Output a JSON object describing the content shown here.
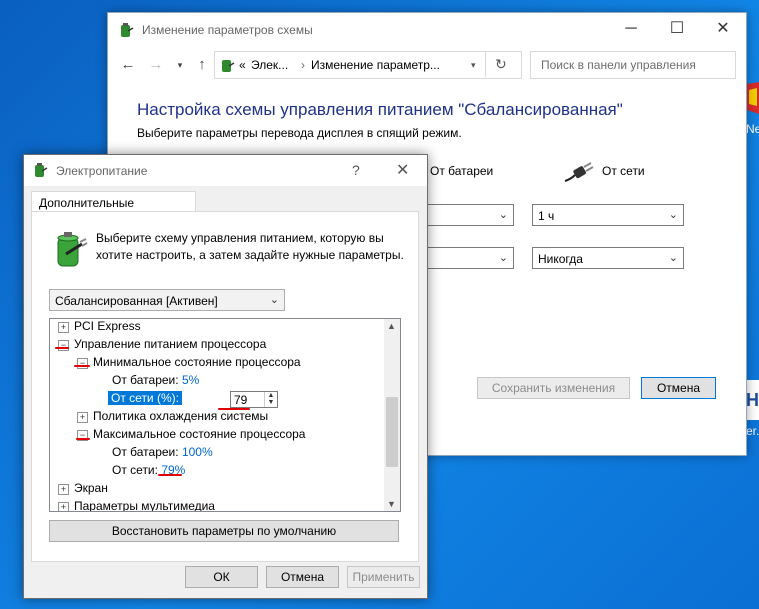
{
  "back_window": {
    "title": "Изменение параметров схемы",
    "breadcrumb_prefix": "«",
    "breadcrumb_1": "Элек...",
    "breadcrumb_sep": "›",
    "breadcrumb_2": "Изменение параметр...",
    "search_placeholder": "Поиск в панели управления",
    "heading": "Настройка схемы управления питанием \"Сбалансированная\"",
    "subheading": "Выберите параметры перевода дисплея в спящий режим.",
    "col_battery": "От батареи",
    "col_ac": "От сети",
    "display_off_ac": "1 ч",
    "sleep_ac": "Никогда",
    "save_button": "Сохранить изменения",
    "cancel_button": "Отмена"
  },
  "dialog": {
    "title": "Электропитание",
    "help": "?",
    "close": "✕",
    "tab": "Дополнительные параметры",
    "intro": "Выберите схему управления питанием, которую вы хотите настроить, а затем задайте нужные параметры.",
    "plan_select": "Сбалансированная [Активен]",
    "tree": {
      "pci_express": "PCI Express",
      "cpu_power": "Управление питанием процессора",
      "min_state": "Минимальное состояние процессора",
      "min_battery_label": "От батареи:",
      "min_battery_value": "5%",
      "min_ac_label": "От сети (%):",
      "min_ac_value": "79",
      "cooling": "Политика охлаждения системы",
      "max_state": "Максимальное состояние процессора",
      "max_battery_label": "От батареи:",
      "max_battery_value": "100%",
      "max_ac_label": "От сети:",
      "max_ac_value": "79%",
      "screen": "Экран",
      "multimedia": "Параметры мультимедиа"
    },
    "restore_button": "Восстановить параметры по умолчанию",
    "ok_button": "ОК",
    "cancel_button": "Отмена",
    "apply_button": "Применить"
  },
  "desktop_edge": {
    "text_1": "Ne",
    "text_2": "er."
  },
  "colors": {
    "link": "#0066cc",
    "highlight": "#0078d7",
    "annotation": "#e00000",
    "heading": "#1e3287"
  }
}
